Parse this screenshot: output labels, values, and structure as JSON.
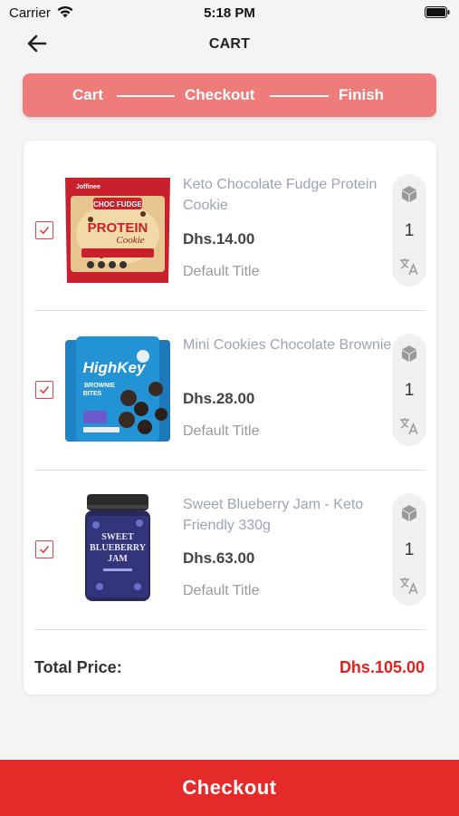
{
  "status_bar": {
    "carrier": "Carrier",
    "time": "5:18 PM"
  },
  "header": {
    "title": "CART"
  },
  "stepper": {
    "steps": [
      {
        "label": "Cart",
        "state": "active"
      },
      {
        "label": "Checkout",
        "state": "inactive"
      },
      {
        "label": "Finish",
        "state": "inactive"
      }
    ]
  },
  "cart": {
    "items": [
      {
        "name": "Keto Chocolate Fudge Protein Cookie",
        "price": "Dhs.14.00",
        "variant": "Default Title",
        "quantity": "1",
        "checked": true,
        "image_icon": "protein-cookie-package",
        "image_text": {
          "brand": "Joffinee",
          "line1": "CHOC FUDGE",
          "line2": "PROTEIN",
          "line3": "Cookie"
        }
      },
      {
        "name": "Mini Cookies Chocolate Brownie",
        "price": "Dhs.28.00",
        "variant": "Default Title",
        "quantity": "1",
        "checked": true,
        "image_icon": "highkey-brownie-bags",
        "image_text": {
          "brand": "HighKey",
          "line1": "BROWNIE",
          "line2": "BITES"
        }
      },
      {
        "name": "Sweet Blueberry Jam - Keto Friendly 330g",
        "price": "Dhs.63.00",
        "variant": "Default Title",
        "quantity": "1",
        "checked": true,
        "image_icon": "blueberry-jam-jar",
        "image_text": {
          "line1": "SWEET",
          "line2": "BLUEBERRY",
          "line3": "JAM"
        }
      }
    ],
    "total_label": "Total Price:",
    "total_value": "Dhs.105.00"
  },
  "checkout_button": {
    "label": "Checkout"
  },
  "colors": {
    "accent": "#e52a2a",
    "stepper_bg": "#f07b7b",
    "total": "#e0211f",
    "product_name": "#9ea3b8"
  }
}
